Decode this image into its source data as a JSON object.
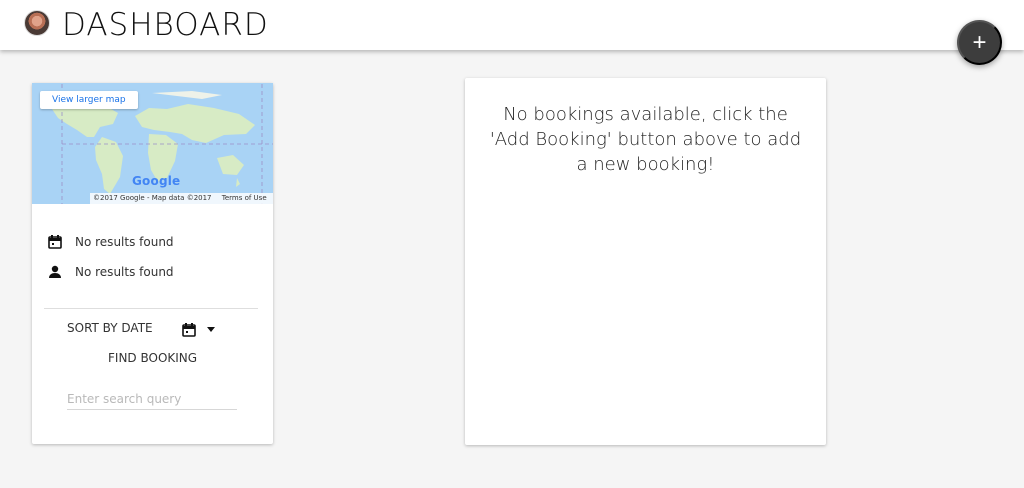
{
  "header": {
    "title": "DASHBOARD"
  },
  "fab": {
    "icon": "+"
  },
  "filter_card": {
    "map": {
      "view_larger_map": "View larger map",
      "logo": "Google",
      "attribution": "©2017 Google - Map data ©2017",
      "terms": "Terms of Use"
    },
    "date_result": "No results found",
    "person_result": "No results found",
    "sort_label": "SORT BY DATE",
    "find_booking": "FIND BOOKING",
    "search_placeholder": "Enter search query"
  },
  "bookings_panel": {
    "empty_message": "No bookings available, click the 'Add Booking' button above to add a new booking!"
  },
  "icons": {
    "fab": "add-icon",
    "date_row": "calendar-icon",
    "person_row": "person-icon",
    "sort": "calendar-icon",
    "sort_toggle": "dropdown-arrow-icon"
  },
  "colors": {
    "header_background": "#ffffff",
    "page_background": "#f5f5f5",
    "fab_background": "#3d3d3d",
    "link": "#1a73e8",
    "map_water": "#a9d3f5",
    "map_land": "#d7ebc5"
  }
}
